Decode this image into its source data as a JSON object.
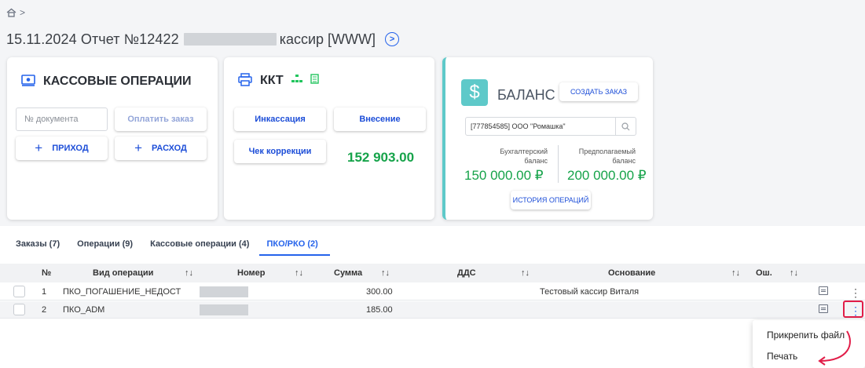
{
  "breadcrumb": {
    "home_icon": "home-icon",
    "separator": ">"
  },
  "header": {
    "title": "15.11.2024 Отчет №12422",
    "cashier": "кассир [WWW]"
  },
  "cash_ops": {
    "title": "КАССОВЫЕ ОПЕРАЦИИ",
    "doc_placeholder": "№ документа",
    "pay_order": "Оплатить заказ",
    "income": "ПРИХОД",
    "expense": "РАСХОД",
    "plus": "+"
  },
  "kkt": {
    "title": "ККТ",
    "collection": "Инкассация",
    "deposit": "Внесение",
    "correction": "Чек коррекции",
    "amount": "152 903.00"
  },
  "balance": {
    "dollar": "$",
    "title": "БАЛАНС",
    "create_order": "СОЗДАТЬ ЗАКАЗ",
    "client": "[777854585] ООО \"Ромашка\"",
    "accounting_label_1": "Бухгалтерский",
    "accounting_label_2": "баланс",
    "expected_label_1": "Предполагаемый",
    "expected_label_2": "баланс",
    "accounting_amount": "150 000.00 ₽",
    "expected_amount": "200 000.00 ₽",
    "history": "ИСТОРИЯ ОПЕРАЦИЙ"
  },
  "tabs": [
    {
      "label": "Заказы (7)"
    },
    {
      "label": "Операции (9)"
    },
    {
      "label": "Кассовые операции (4)"
    },
    {
      "label": "ПКО/РКО (2)"
    }
  ],
  "table": {
    "columns": {
      "num": "№",
      "op_type": "Вид операции",
      "number": "Номер",
      "sum": "Сумма",
      "dds": "ДДС",
      "basis": "Основание",
      "err": "Ош.",
      "sort": "↑↓"
    },
    "rows": [
      {
        "num": "1",
        "op_type": "ПКО_ПОГАШЕНИЕ_НЕДОСТ",
        "sum": "300.00",
        "basis": "Тестовый кассир Виталя"
      },
      {
        "num": "2",
        "op_type": "ПКО_ADM",
        "sum": "185.00",
        "basis": ""
      }
    ]
  },
  "context_menu": {
    "attach": "Прикрепить файл",
    "print": "Печать"
  },
  "colors": {
    "accent": "#2563eb",
    "green": "#16a34a",
    "teal": "#5ec9c9",
    "highlight": "#e11d48"
  }
}
